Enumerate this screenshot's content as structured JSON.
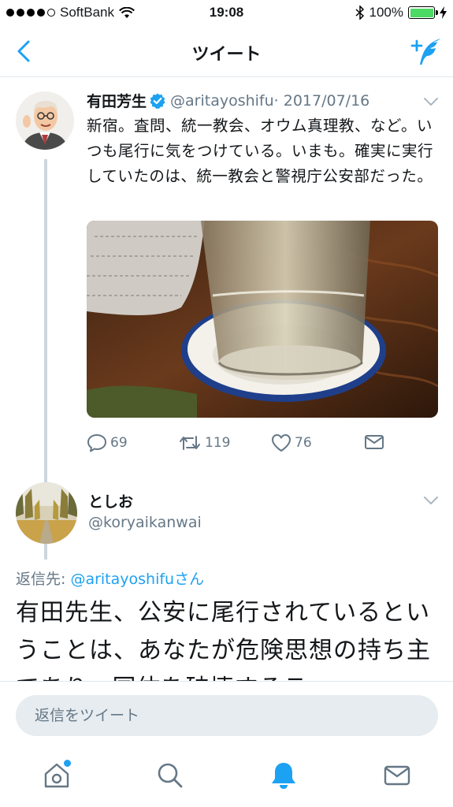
{
  "status_bar": {
    "carrier": "SoftBank",
    "time": "19:08",
    "battery": "100%",
    "battery_level": 1.0
  },
  "nav": {
    "title": "ツイート",
    "back_icon": "chevron-left-icon",
    "compose_icon": "compose-tweet-icon"
  },
  "tweet": {
    "name": "有田芳生",
    "handle": "@aritayoshifu",
    "date": "· 2017/07/16",
    "text": "新宿。査問、統一教会、オウム真理教、など。いつも尾行に気をつけている。いまも。確実に実行していたのは、統一教会と警視庁公安部だった。",
    "image_icon": "glass-photo",
    "reply_count": "69",
    "retweet_count": "119",
    "like_count": "76"
  },
  "reply": {
    "name": "としお",
    "handle": "@koryaikanwai",
    "reply_to_prefix": "返信先: ",
    "reply_to_mention": "@aritayoshifu",
    "reply_to_suffix": "さん",
    "text": "有田先生、公安に尾行されているということは、あなたが危険思想の持ち主であり、国体を破壊するテ"
  },
  "reply_bar": {
    "placeholder": "返信をツイート"
  },
  "tabs": [
    "home-icon",
    "search-icon",
    "notifications-icon",
    "messages-icon"
  ],
  "colors": {
    "accent": "#1da1f2",
    "muted": "#657786",
    "text": "#14171a"
  }
}
